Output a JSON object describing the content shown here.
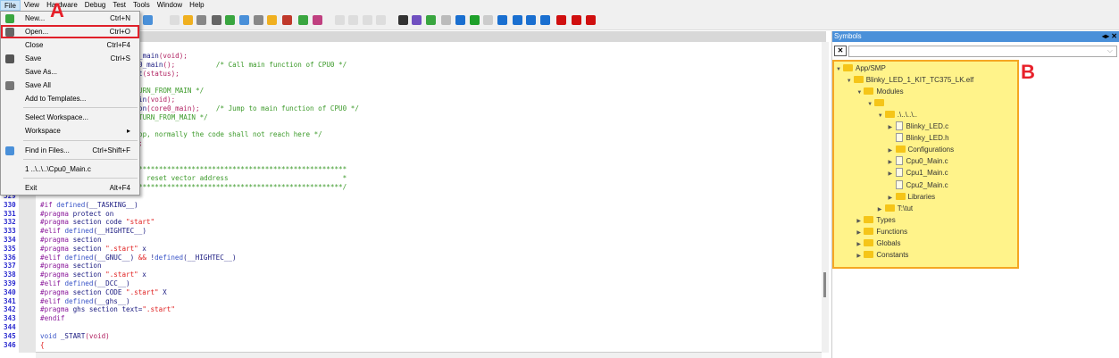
{
  "menubar": [
    "File",
    "View",
    "Hardware",
    "Debug",
    "Test",
    "Tools",
    "Window",
    "Help"
  ],
  "file_menu": [
    {
      "label": "New...",
      "shortcut": "Ctrl+N",
      "icon": "new-file-icon",
      "color": "#3aa640"
    },
    {
      "label": "Open...",
      "shortcut": "Ctrl+O",
      "icon": "open-icon",
      "color": "#666666"
    },
    {
      "label": "Close",
      "shortcut": "Ctrl+F4"
    },
    {
      "label": "Save",
      "shortcut": "Ctrl+S",
      "icon": "save-icon",
      "color": "#555555"
    },
    {
      "label": "Save As...",
      "shortcut": ""
    },
    {
      "label": "Save All",
      "shortcut": "",
      "icon": "save-all-icon",
      "color": "#777777"
    },
    {
      "label": "Add to Templates...",
      "shortcut": ""
    },
    {
      "label": "Select Workspace...",
      "shortcut": ""
    },
    {
      "label": "Workspace",
      "shortcut": "▸"
    },
    {
      "label": "Find in Files...",
      "shortcut": "Ctrl+Shift+F",
      "icon": "find-in-files-icon",
      "color": "#4a90d9"
    },
    {
      "label": "1 ..\\..\\..\\Cpu0_Main.c",
      "shortcut": ""
    },
    {
      "label": "Exit",
      "shortcut": "Alt+F4"
    }
  ],
  "annotations": {
    "a": "A",
    "b": "B"
  },
  "editor": {
    "partial_lines": [
      [
        [
          "_main",
          "c-txt"
        ],
        [
          "(void);",
          "c-par"
        ]
      ],
      [
        [
          "0_main",
          "c-txt"
        ],
        [
          "();",
          "c-par"
        ],
        [
          "          /* Call main function of CPU0 */",
          "c-com"
        ]
      ],
      [
        [
          "t",
          "c-txt"
        ],
        [
          "(status);",
          "c-par"
        ]
      ],
      [],
      [
        [
          "URN_FROM_MAIN */",
          "c-com"
        ]
      ],
      [
        [
          "in",
          "c-txt"
        ],
        [
          "(void);",
          "c-par"
        ]
      ],
      [
        [
          "on",
          "c-txt"
        ],
        [
          "(core0_main);",
          "c-par"
        ],
        [
          "    /* Jump to main function of CPU0 */",
          "c-com"
        ]
      ],
      [
        [
          "TURN_FROM_MAIN */",
          "c-com"
        ]
      ],
      [],
      [
        [
          "op, normally the code shall not reach here */",
          "c-com"
        ]
      ],
      [
        [
          ";",
          "c-par"
        ]
      ],
      [],
      [],
      [
        [
          "***************************************************",
          "c-com"
        ]
      ],
      [
        [
          "  reset vector address                            *",
          "c-com"
        ]
      ],
      [
        [
          "**************************************************/",
          "c-com"
        ]
      ]
    ],
    "lines": [
      {
        "n": "329",
        "seg": []
      },
      {
        "n": "330",
        "seg": [
          [
            "#if ",
            "c-dir"
          ],
          [
            "defined",
            "c-def"
          ],
          [
            "(__TASKING__)",
            "c-txt"
          ]
        ]
      },
      {
        "n": "331",
        "seg": [
          [
            "#pragma ",
            "c-dir"
          ],
          [
            "protect on",
            "c-txt"
          ]
        ]
      },
      {
        "n": "332",
        "seg": [
          [
            "#pragma ",
            "c-dir"
          ],
          [
            "section code ",
            "c-txt"
          ],
          [
            "\"start\"",
            "c-str"
          ]
        ]
      },
      {
        "n": "333",
        "seg": [
          [
            "#elif ",
            "c-dir"
          ],
          [
            "defined",
            "c-def"
          ],
          [
            "(__HIGHTEC__)",
            "c-txt"
          ]
        ]
      },
      {
        "n": "334",
        "seg": [
          [
            "#pragma ",
            "c-dir"
          ],
          [
            "section",
            "c-txt"
          ]
        ]
      },
      {
        "n": "335",
        "seg": [
          [
            "#pragma ",
            "c-dir"
          ],
          [
            "section ",
            "c-txt"
          ],
          [
            "\".start\"",
            "c-str"
          ],
          [
            " x",
            "c-txt"
          ]
        ]
      },
      {
        "n": "336",
        "seg": [
          [
            "#elif ",
            "c-dir"
          ],
          [
            "defined",
            "c-def"
          ],
          [
            "(__GNUC__) ",
            "c-txt"
          ],
          [
            "&&",
            "c-str"
          ],
          [
            " !",
            "c-txt"
          ],
          [
            "defined",
            "c-def"
          ],
          [
            "(__HIGHTEC__)",
            "c-txt"
          ]
        ]
      },
      {
        "n": "337",
        "seg": [
          [
            "#pragma ",
            "c-dir"
          ],
          [
            "section",
            "c-txt"
          ]
        ]
      },
      {
        "n": "338",
        "seg": [
          [
            "#pragma ",
            "c-dir"
          ],
          [
            "section ",
            "c-txt"
          ],
          [
            "\".start\"",
            "c-str"
          ],
          [
            " x",
            "c-txt"
          ]
        ]
      },
      {
        "n": "339",
        "seg": [
          [
            "#elif ",
            "c-dir"
          ],
          [
            "defined",
            "c-def"
          ],
          [
            "(__DCC__)",
            "c-txt"
          ]
        ]
      },
      {
        "n": "340",
        "seg": [
          [
            "#pragma ",
            "c-dir"
          ],
          [
            "section CODE ",
            "c-txt"
          ],
          [
            "\".start\"",
            "c-str"
          ],
          [
            " X",
            "c-txt"
          ]
        ]
      },
      {
        "n": "341",
        "seg": [
          [
            "#elif ",
            "c-dir"
          ],
          [
            "defined",
            "c-def"
          ],
          [
            "(__ghs__)",
            "c-txt"
          ]
        ]
      },
      {
        "n": "342",
        "seg": [
          [
            "#pragma ",
            "c-dir"
          ],
          [
            "ghs section text=",
            "c-txt"
          ],
          [
            "\".start\"",
            "c-str"
          ]
        ]
      },
      {
        "n": "343",
        "seg": [
          [
            "#endif",
            "c-dir"
          ]
        ]
      },
      {
        "n": "344",
        "seg": []
      },
      {
        "n": "345",
        "seg": [
          [
            "void ",
            "c-def"
          ],
          [
            "_START",
            "c-txt"
          ],
          [
            "(void)",
            "c-par"
          ]
        ]
      },
      {
        "n": "346",
        "seg": [
          [
            "{",
            "c-str"
          ]
        ]
      }
    ]
  },
  "symbols": {
    "title": "Symbols",
    "buttons": "◂▸ ✕",
    "filter_clear": "✕",
    "dropdown": "⌵",
    "tree": [
      {
        "label": "App/SMP",
        "depth": 0,
        "type": "folder",
        "state": "open"
      },
      {
        "label": "Blinky_LED_1_KIT_TC375_LK.elf",
        "depth": 1,
        "type": "folder",
        "state": "open"
      },
      {
        "label": "Modules",
        "depth": 2,
        "type": "folder",
        "state": "open"
      },
      {
        "label": "",
        "depth": 3,
        "type": "folder",
        "state": "open"
      },
      {
        "label": ".\\..\\..\\..",
        "depth": 4,
        "type": "folder",
        "state": "open"
      },
      {
        "label": "Blinky_LED.c",
        "depth": 5,
        "type": "file",
        "state": "closed"
      },
      {
        "label": "Blinky_LED.h",
        "depth": 5,
        "type": "file",
        "state": "none"
      },
      {
        "label": "Configurations",
        "depth": 5,
        "type": "folder",
        "state": "closed"
      },
      {
        "label": "Cpu0_Main.c",
        "depth": 5,
        "type": "file",
        "state": "closed"
      },
      {
        "label": "Cpu1_Main.c",
        "depth": 5,
        "type": "file",
        "state": "closed"
      },
      {
        "label": "Cpu2_Main.c",
        "depth": 5,
        "type": "file",
        "state": "none"
      },
      {
        "label": "Libraries",
        "depth": 5,
        "type": "folder",
        "state": "closed"
      },
      {
        "label": "T:\\tut",
        "depth": 4,
        "type": "folder",
        "state": "closed"
      },
      {
        "label": "Types",
        "depth": 2,
        "type": "folder",
        "state": "closed"
      },
      {
        "label": "Functions",
        "depth": 2,
        "type": "folder",
        "state": "closed"
      },
      {
        "label": "Globals",
        "depth": 2,
        "type": "folder",
        "state": "closed"
      },
      {
        "label": "Constants",
        "depth": 2,
        "type": "folder",
        "state": "closed"
      }
    ]
  },
  "toolbar_icons": [
    {
      "name": "find-icon",
      "color": "#4a90d9"
    },
    {
      "name": "disabled-icon",
      "color": "#dddddd"
    },
    {
      "name": "folder-icon",
      "color": "#f0b020"
    },
    {
      "name": "target-icon",
      "color": "#888888"
    },
    {
      "name": "watch-icon",
      "color": "#666666"
    },
    {
      "name": "download-icon",
      "color": "#3aa640"
    },
    {
      "name": "inspect-icon",
      "color": "#4a90d9"
    },
    {
      "name": "memory-icon",
      "color": "#888888"
    },
    {
      "name": "flag-icon",
      "color": "#f0b020"
    },
    {
      "name": "registers-icon",
      "color": "#c0392b"
    },
    {
      "name": "run-to-icon",
      "color": "#3aa640"
    },
    {
      "name": "trace-icon",
      "color": "#c04080"
    },
    {
      "name": "flash-icon",
      "color": "#dddddd"
    },
    {
      "name": "flash2-icon",
      "color": "#dddddd"
    },
    {
      "name": "flash3-icon",
      "color": "#dddddd"
    },
    {
      "name": "flash4-icon",
      "color": "#dddddd"
    },
    {
      "name": "connect-icon",
      "color": "#333333"
    },
    {
      "name": "connect2-icon",
      "color": "#7050c0"
    },
    {
      "name": "attach-icon",
      "color": "#3aa640"
    },
    {
      "name": "settings-icon",
      "color": "#bbbbbb"
    },
    {
      "name": "reset-icon",
      "color": "#1a6fd0"
    },
    {
      "name": "run-icon",
      "color": "#1fa02a"
    },
    {
      "name": "stop-icon",
      "color": "#cccccc"
    },
    {
      "name": "step-into-icon",
      "color": "#1a6fd0"
    },
    {
      "name": "step-over-icon",
      "color": "#1a6fd0"
    },
    {
      "name": "step-out-icon",
      "color": "#1a6fd0"
    },
    {
      "name": "step-return-icon",
      "color": "#1a6fd0"
    },
    {
      "name": "breakpoint-icon",
      "color": "#d01010"
    },
    {
      "name": "breakpoint-window-icon",
      "color": "#d01010"
    },
    {
      "name": "breakpoint-settings-icon",
      "color": "#d01010"
    }
  ]
}
